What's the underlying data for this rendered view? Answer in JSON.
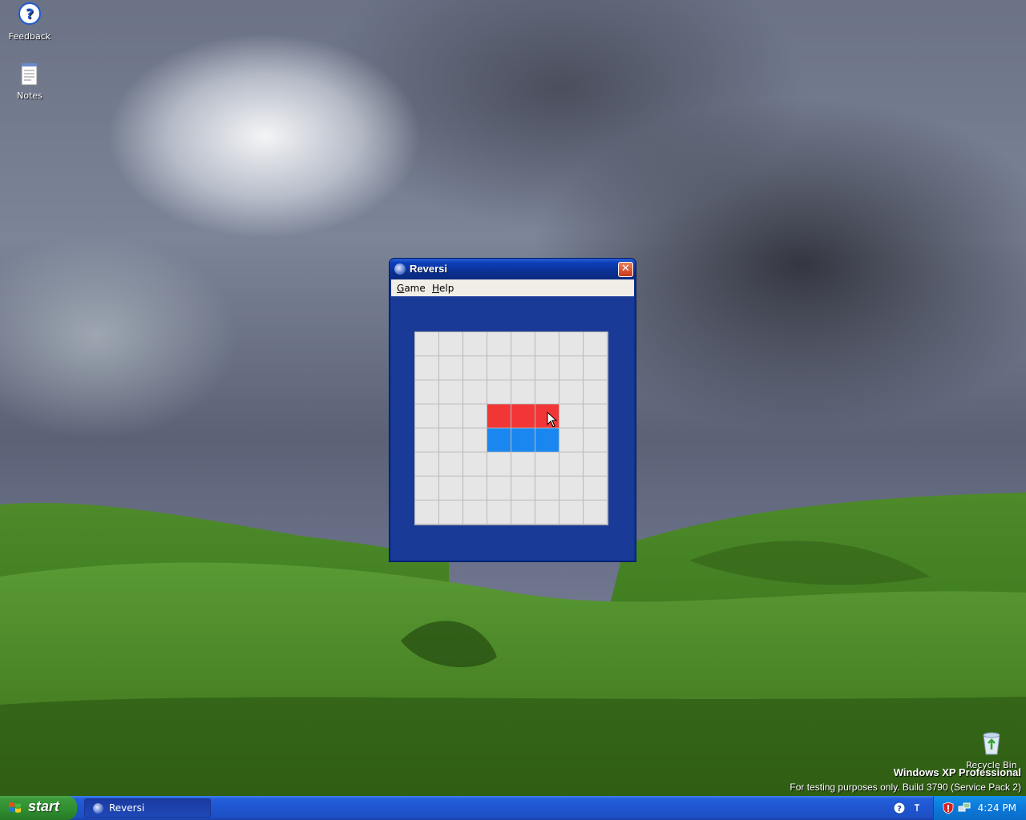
{
  "desktop": {
    "icons": [
      {
        "label": "Feedback"
      },
      {
        "label": "Notes"
      },
      {
        "label": "Recycle Bin"
      }
    ],
    "watermark_line1": "Windows XP Professional",
    "watermark_line2": "For testing purposes only. Build 3790 (Service Pack 2)"
  },
  "window": {
    "title": "Reversi",
    "menu": [
      {
        "label": "Game",
        "accel": "G"
      },
      {
        "label": "Help",
        "accel": "H"
      }
    ],
    "board": {
      "size": 8,
      "red_cells": [
        [
          3,
          3
        ],
        [
          3,
          4
        ],
        [
          3,
          5
        ]
      ],
      "blue_cells": [
        [
          4,
          3
        ],
        [
          4,
          4
        ],
        [
          4,
          5
        ]
      ]
    },
    "colors": {
      "red": "#f23636",
      "blue": "#1a86f0",
      "empty": "#e6e6e6",
      "client_bg": "#1a3a98"
    }
  },
  "taskbar": {
    "start_label": "start",
    "tasks": [
      {
        "label": "Reversi"
      }
    ],
    "clock": "4:24 PM"
  }
}
